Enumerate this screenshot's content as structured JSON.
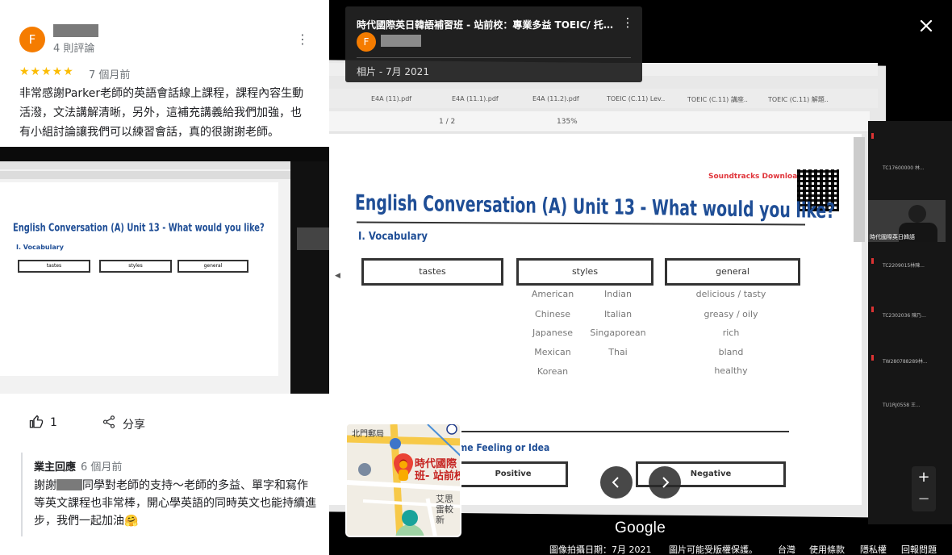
{
  "review": {
    "avatar_letter": "F",
    "reviewer_count": "4 則評論",
    "stars": "★★★★★",
    "rating": 5,
    "date": "7 個月前",
    "text": "非常感謝Parker老師的英語會話線上課程，課程內容生動活潑，文法講解清晰，另外，這補充講義給我們加強，也有小組討論讓我們可以練習會話，真的很謝謝老師。",
    "likes": "1",
    "share_label": "分享"
  },
  "owner_reply": {
    "label": "業主回應",
    "date": "6 個月前",
    "text_before": "謝謝",
    "text_after": "同學對老師的支持～老師的多益、單字和寫作等英文課程也非常棒，開心學英語的同時英文也能持續進步，我們一起加油🤗"
  },
  "viewer": {
    "place_title": "時代國際英日韓語補習班 - 站前校：專業多益 TOEIC/ 托福 ...",
    "avatar_letter": "F",
    "meta": "相片 - 7月 2021",
    "google_logo": "Google",
    "footer": {
      "capture_date": "圖像拍攝日期：7月 2021",
      "copyright": "圖片可能受版權保護。",
      "region": "台灣",
      "terms": "使用條款",
      "privacy": "隱私權",
      "report": "回報問題"
    }
  },
  "minimap": {
    "street": "北門郵局",
    "place_label_1": "時代國際",
    "place_label_2": "班- 站前校",
    "nearby_1": "艾思",
    "nearby_2": "雷較新"
  },
  "photo_content": {
    "app_tabs": [
      "E4A (11).pdf",
      "E4A (11.1).pdf",
      "E4A (11.2).pdf",
      "TOEIC (C.11) Lev..",
      "TOEIC (C.11) 講座..",
      "TOEIC (C.11) 解題.."
    ],
    "page_indicator": "1 / 2",
    "zoom": "135%",
    "download_label": "Soundtracks Download:",
    "title": "English Conversation (A)    Unit 13 - What would you like?",
    "section_1": "I. Vocabulary",
    "boxes": [
      "tastes",
      "styles",
      "general"
    ],
    "styles_col1": [
      "American",
      "Chinese",
      "Japanese",
      "Mexican",
      "Korean"
    ],
    "styles_col2": [
      "Indian",
      "Italian",
      "Singaporean",
      "Thai"
    ],
    "general": [
      "delicious / tasty",
      "greasy / oily",
      "rich",
      "bland",
      "healthy"
    ],
    "section_2": "II. Having the Same Feeling or Idea",
    "section_2_visible": "me Feeling or Idea",
    "positive": "Positive",
    "negative": "Negative",
    "cam_label": "時代國際英日韓語",
    "side_labels": [
      "TC17600000 林...",
      "TC2209015林陳...",
      "TC2302036 陳乃...",
      "TW280788289林...",
      "TU1RJ0558 王..."
    ]
  }
}
